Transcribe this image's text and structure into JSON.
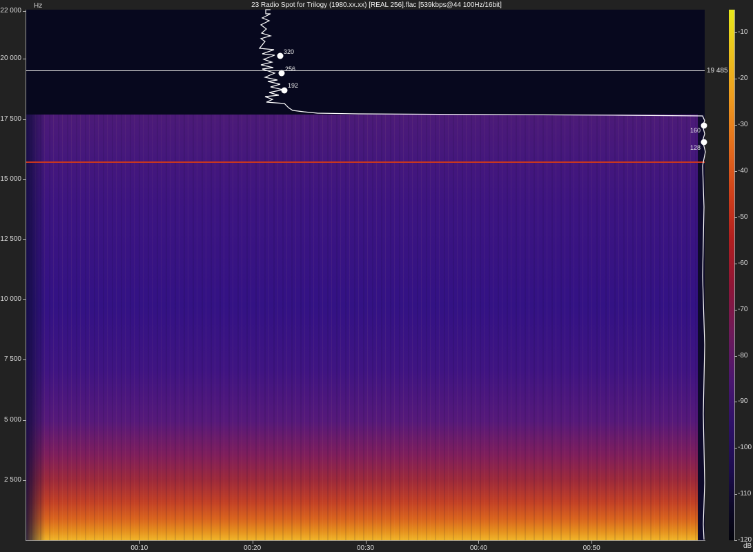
{
  "window": {
    "title": "23 Radio Spot for Trilogy (1980.xx.xx) [REAL 256].flac [539kbps@44 100Hz/16bit]"
  },
  "axes": {
    "y_unit": "Hz",
    "colorbar_unit": "dB"
  },
  "cutoff": {
    "label": "19 485",
    "frequency_hz": 19485
  },
  "bitrate_markers": [
    {
      "label": "320"
    },
    {
      "label": "256"
    },
    {
      "label": "192"
    },
    {
      "label": "160"
    },
    {
      "label": "128"
    }
  ],
  "colors": {
    "background": "#222222",
    "plot_background": "#07081e",
    "hum_line": "#c8361f",
    "trace": "#ffffff"
  },
  "chart_data": {
    "type": "heatmap",
    "title": "23 Radio Spot for Trilogy (1980.xx.xx) [REAL 256].flac [539kbps@44 100Hz/16bit]",
    "ylabel": "Hz",
    "colorbar_label": "dB",
    "y_ticks": [
      "22 000",
      "20 000",
      "17 500",
      "15 000",
      "12 500",
      "10 000",
      "7 500",
      "5 000",
      "2 500"
    ],
    "y_tick_values": [
      22000,
      20000,
      17500,
      15000,
      12500,
      10000,
      7500,
      5000,
      2500
    ],
    "ylim": [
      0,
      22050
    ],
    "x_ticks": [
      "00:10",
      "00:20",
      "00:30",
      "00:40",
      "00:50"
    ],
    "x_tick_seconds": [
      10,
      20,
      30,
      40,
      50
    ],
    "xlim_seconds": [
      0,
      60
    ],
    "colorbar_ticks": [
      "-10",
      "-20",
      "-30",
      "-40",
      "-50",
      "-60",
      "-70",
      "-80",
      "-90",
      "-100",
      "-110",
      "-120"
    ],
    "colorbar_values": [
      -10,
      -20,
      -30,
      -40,
      -50,
      -60,
      -70,
      -80,
      -90,
      -100,
      -110,
      -120
    ],
    "colorbar_range": [
      -120,
      -5
    ],
    "lowpass_cutoff_hz": 17650,
    "hum_line_hz": 15750,
    "marked_cutoff_hz": 19485,
    "grid": false
  }
}
